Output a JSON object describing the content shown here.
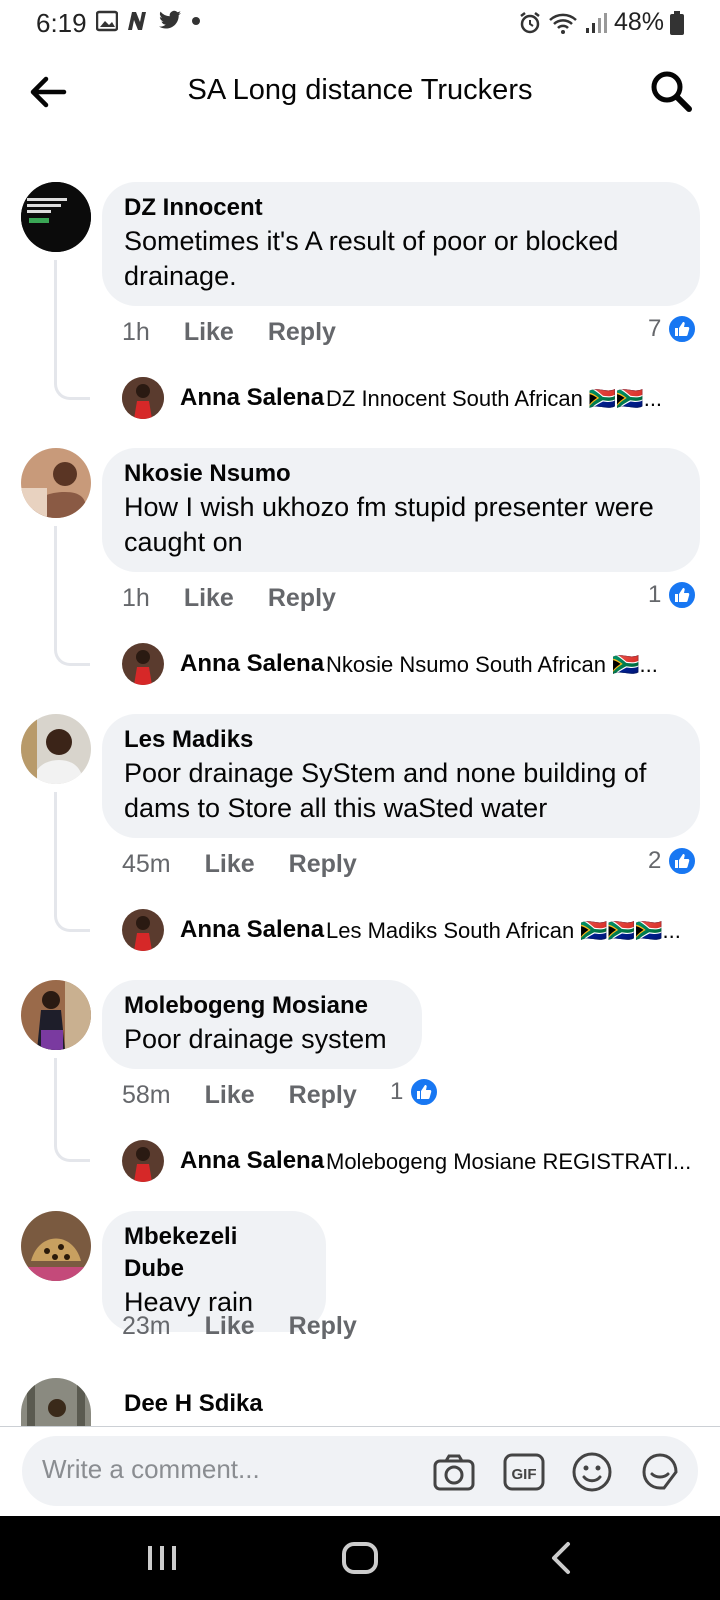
{
  "status_bar": {
    "time": "6:19",
    "battery": "48%",
    "left_icons": [
      "gallery-icon",
      "n-app-icon",
      "twitter-icon",
      "dot-icon"
    ],
    "right_icons": [
      "alarm-icon",
      "wifi-icon",
      "signal-icon",
      "battery-icon"
    ]
  },
  "header": {
    "title": "SA Long distance Truckers"
  },
  "comments": [
    {
      "author": "DZ Innocent",
      "text": "Sometimes it's A result of poor or blocked drainage.",
      "time": "1h",
      "like_label": "Like",
      "reply_label": "Reply",
      "reaction_count": "7",
      "reply": {
        "author": "Anna Salena",
        "preview": "DZ Innocent South African 🇿🇦🇿🇦..."
      }
    },
    {
      "author": "Nkosie Nsumo",
      "text": "How I wish ukhozo fm stupid presenter were caught on",
      "time": "1h",
      "like_label": "Like",
      "reply_label": "Reply",
      "reaction_count": "1",
      "reply": {
        "author": "Anna Salena",
        "preview": "Nkosie Nsumo South African 🇿🇦..."
      }
    },
    {
      "author": "Les Madiks",
      "text": "Poor drainage SyStem and none building of dams to Store all this waSted water",
      "time": "45m",
      "like_label": "Like",
      "reply_label": "Reply",
      "reaction_count": "2",
      "reply": {
        "author": "Anna Salena",
        "preview": "Les Madiks South African 🇿🇦🇿🇦🇿🇦..."
      }
    },
    {
      "author": "Molebogeng Mosiane",
      "text": "Poor drainage system",
      "time": "58m",
      "like_label": "Like",
      "reply_label": "Reply",
      "reaction_count": "1",
      "reply": {
        "author": "Anna Salena",
        "preview": "Molebogeng Mosiane REGISTRATI..."
      }
    },
    {
      "author": "Mbekezeli Dube",
      "text": "Heavy rain",
      "time": "23m",
      "like_label": "Like",
      "reply_label": "Reply"
    },
    {
      "author": "Dee H Sdika"
    }
  ],
  "composer": {
    "placeholder": "Write a comment...",
    "icons": [
      "camera-icon",
      "gif-icon",
      "emoji-icon",
      "sticker-icon"
    ]
  },
  "colors": {
    "bubble": "#f0f2f5",
    "like_blue": "#1877f2",
    "meta_gray": "#65676b"
  }
}
